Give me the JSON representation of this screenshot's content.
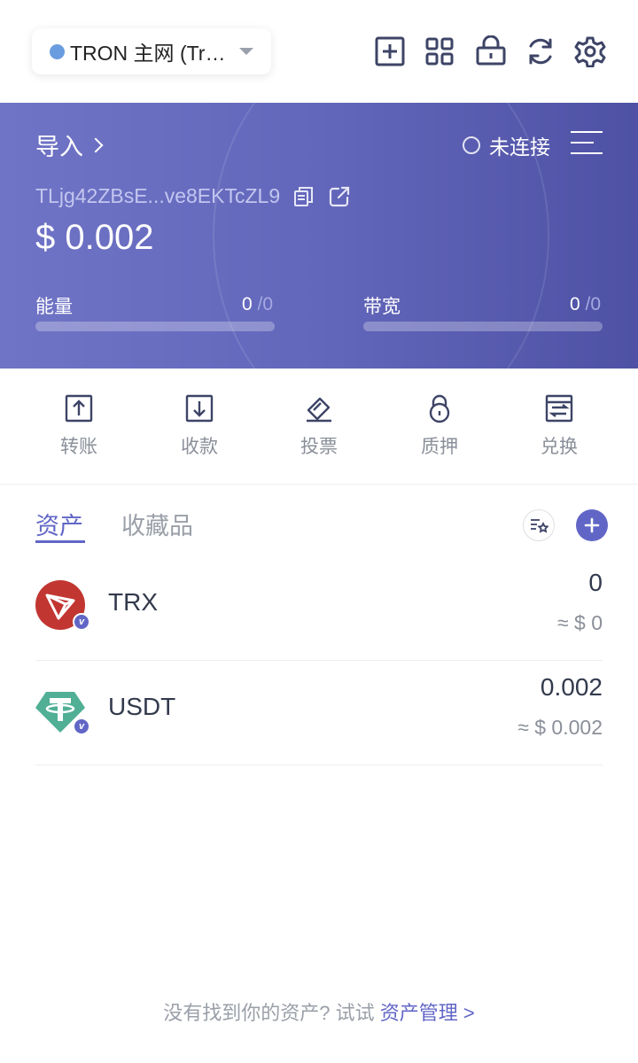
{
  "header": {
    "network_label": "TRON 主网 (Tr…",
    "icons": [
      "add-square-icon",
      "apps-grid-icon",
      "wallet-lock-icon",
      "refresh-icon",
      "gear-icon"
    ]
  },
  "account": {
    "import_label": "导入",
    "connection_status": "未连接",
    "address": "TLjg42ZBsE...ve8EKTcZL9",
    "balance": "$ 0.002",
    "energy": {
      "label": "能量",
      "value": "0",
      "max": "/0"
    },
    "bandwidth": {
      "label": "带宽",
      "value": "0",
      "max": "/0"
    }
  },
  "actions": [
    {
      "label": "转账",
      "icon": "transfer-out-icon"
    },
    {
      "label": "收款",
      "icon": "receive-icon"
    },
    {
      "label": "投票",
      "icon": "vote-icon"
    },
    {
      "label": "质押",
      "icon": "lock-icon"
    },
    {
      "label": "兑换",
      "icon": "swap-icon"
    }
  ],
  "tabs": {
    "assets": "资产",
    "collectibles": "收藏品"
  },
  "tokens": [
    {
      "symbol": "TRX",
      "amount": "0",
      "usd": "≈ $ 0",
      "badge": "v"
    },
    {
      "symbol": "USDT",
      "amount": "0.002",
      "usd": "≈ $ 0.002",
      "badge": "v"
    }
  ],
  "footer": {
    "text": "没有找到你的资产? 试试 ",
    "link": "资产管理 >"
  },
  "colors": {
    "accent": "#6166c6",
    "card_gradient_start": "#7074c6",
    "card_gradient_end": "#4e51a4",
    "trx_red": "#c23631",
    "usdt_green": "#50af95"
  }
}
